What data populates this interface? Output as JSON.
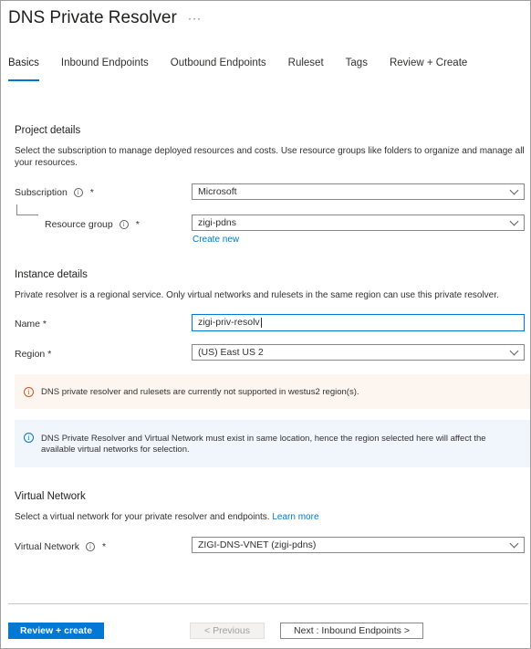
{
  "header": {
    "title": "DNS Private Resolver",
    "more_glyph": "···"
  },
  "tabs": [
    {
      "label": "Basics",
      "active": true
    },
    {
      "label": "Inbound Endpoints",
      "active": false
    },
    {
      "label": "Outbound Endpoints",
      "active": false
    },
    {
      "label": "Ruleset",
      "active": false
    },
    {
      "label": "Tags",
      "active": false
    },
    {
      "label": "Review + Create",
      "active": false
    }
  ],
  "project": {
    "title": "Project details",
    "description": "Select the subscription to manage deployed resources and costs. Use resource groups like folders to organize and manage all your resources.",
    "subscription": {
      "label": "Subscription",
      "required": "*",
      "value": "Microsoft"
    },
    "resource_group": {
      "label": "Resource group",
      "required": "*",
      "value": "zigi-pdns",
      "create_new": "Create new"
    }
  },
  "instance": {
    "title": "Instance details",
    "description": "Private resolver is a regional service. Only virtual networks and rulesets in the same region can use this private resolver.",
    "name": {
      "label": "Name *",
      "value": "zigi-priv-resolv"
    },
    "region": {
      "label": "Region *",
      "value": "(US) East US 2"
    }
  },
  "banners": {
    "warning": "DNS private resolver and rulesets are currently not supported in westus2 region(s).",
    "info": "DNS Private Resolver and Virtual Network must exist in same location, hence the region selected here will affect the available virtual networks for selection."
  },
  "vnet": {
    "title": "Virtual Network",
    "description": "Select a virtual network for your private resolver and endpoints.",
    "learn_more": "Learn more",
    "field": {
      "label": "Virtual Network",
      "required": "*",
      "value": "ZIGI-DNS-VNET (zigi-pdns)"
    }
  },
  "footer": {
    "review_create": "Review + create",
    "previous": "< Previous",
    "next": "Next : Inbound Endpoints >"
  },
  "colors": {
    "accent": "#0078d4",
    "warning_bg": "#fdf6f0",
    "info_bg": "#f0f6fc"
  }
}
